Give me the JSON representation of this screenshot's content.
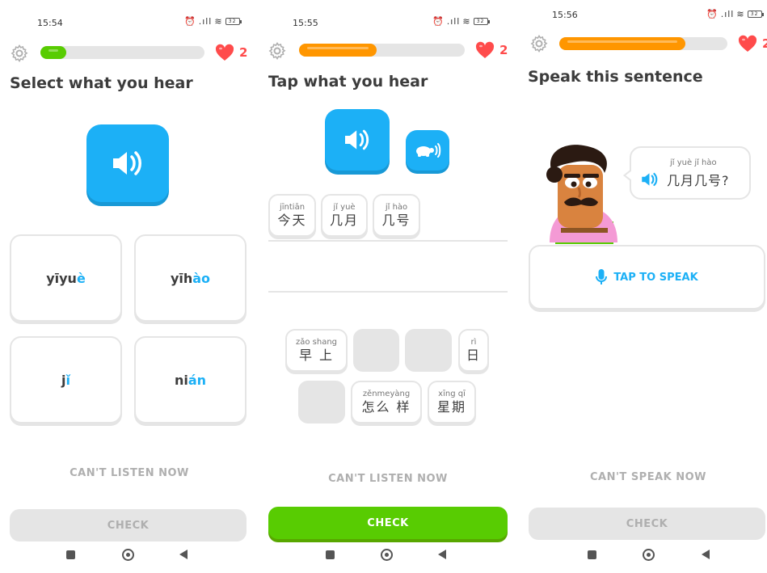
{
  "colors": {
    "accent_blue": "#1cb0f6",
    "green": "#58cc02",
    "orange": "#ff9600",
    "heart_red": "#ff4b4b",
    "disabled_gray": "#e5e5e5",
    "disabled_text": "#afafaf"
  },
  "screens": [
    {
      "status": {
        "time": "15:54",
        "battery": "32"
      },
      "settings_icon": "gear-icon",
      "progress": 0.16,
      "progress_color": "#58cc02",
      "hearts": "2",
      "heading": "Select what you hear",
      "audio_icon": "speaker-icon",
      "choices": [
        {
          "plain": "yīyu",
          "hl": "è"
        },
        {
          "plain": "yīh",
          "hl": "ào"
        },
        {
          "plain": "j",
          "hl": "ǐ"
        },
        {
          "plain": "ni",
          "hl": "án"
        }
      ],
      "skip_label": "CAN'T LISTEN NOW",
      "check_label": "CHECK",
      "check_state": "disabled"
    },
    {
      "status": {
        "time": "15:55",
        "battery": "32"
      },
      "settings_icon": "gear-icon",
      "progress": 0.47,
      "progress_color": "#ff9600",
      "hearts": "2",
      "heading": "Tap what you hear",
      "audio_icon": "speaker-icon",
      "slow_audio_icon": "turtle-icon",
      "answer_tiles": [
        {
          "pinyin": "jīntiān",
          "hanzi": "今天"
        },
        {
          "pinyin": "jǐ yuè",
          "hanzi": "几月"
        },
        {
          "pinyin": "jǐ hào",
          "hanzi": "几号"
        }
      ],
      "bank_tiles": [
        {
          "pinyin": "zǎo shang",
          "hanzi": "早 上",
          "empty": false
        },
        {
          "pinyin": "",
          "hanzi": "",
          "empty": true
        },
        {
          "pinyin": "",
          "hanzi": "",
          "empty": true
        },
        {
          "pinyin": "rì",
          "hanzi": "日",
          "empty": false
        },
        {
          "pinyin": "",
          "hanzi": "",
          "empty": true
        },
        {
          "pinyin": "zěnmeyàng",
          "hanzi": "怎么 样",
          "empty": false
        },
        {
          "pinyin": "xīng qī",
          "hanzi": "星期",
          "empty": false
        }
      ],
      "skip_label": "CAN'T LISTEN NOW",
      "check_label": "CHECK",
      "check_state": "active"
    },
    {
      "status": {
        "time": "15:56",
        "battery": "32"
      },
      "settings_icon": "gear-icon",
      "progress": 0.75,
      "progress_color": "#ff9600",
      "hearts": "2",
      "heading": "Speak this sentence",
      "bubble": {
        "pinyin": "jǐ yuè jǐ hào",
        "hanzi": "几月几号?"
      },
      "speak_label": "TAP TO SPEAK",
      "mic_icon": "microphone-icon",
      "skip_label": "CAN'T SPEAK NOW",
      "check_label": "CHECK",
      "check_state": "disabled"
    }
  ],
  "nav": {
    "square": "recent-apps-icon",
    "circle": "home-icon",
    "back": "back-icon"
  }
}
